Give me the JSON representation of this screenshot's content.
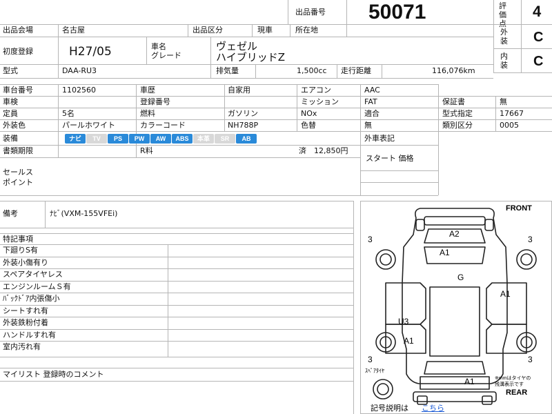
{
  "header": {
    "lot_label": "出品番号",
    "lot_number": "50071",
    "venue_label": "出品会場",
    "venue_value": "名古屋",
    "category_label": "出品区分",
    "category_value": "現車",
    "location_label": "所在地",
    "location_value": ""
  },
  "scores": {
    "eval_label": "評価点",
    "eval_value": "4",
    "exterior_label": "外装",
    "exterior_value": "C",
    "interior_label": "内装",
    "interior_value": "C"
  },
  "vehicle": {
    "first_reg_label": "初度登録",
    "first_reg_value": "H27/05",
    "name_label": "車名",
    "grade_label": "グレード",
    "name_value": "ヴェゼル",
    "grade_value": "ハイブリッドZ",
    "model_label": "型式",
    "model_value": "DAA-RU3",
    "displacement_label": "排気量",
    "displacement_value": "1,500cc",
    "mileage_label": "走行距離",
    "mileage_value": "116,076km"
  },
  "details": {
    "chassis_label": "車台番号",
    "chassis_value": "1102560",
    "history_label": "車歴",
    "history_value": "自家用",
    "ac_label": "エアコン",
    "ac_value": "AAC",
    "inspection_label": "車検",
    "regno_label": "登録番号",
    "mission_label": "ミッション",
    "mission_value": "FAT",
    "warranty_label": "保証書",
    "warranty_value": "無",
    "capacity_label": "定員",
    "capacity_value": "5名",
    "fuel_label": "燃料",
    "fuel_value": "ガソリン",
    "nox_label": "NOx",
    "nox_value": "適合",
    "typecert_label": "型式指定",
    "typecert_value": "17667",
    "color_label": "外装色",
    "color_value": "パールホワイト",
    "colorcode_label": "カラーコード",
    "colorcode_value": "NH788P",
    "repaint_label": "色替",
    "repaint_value": "無",
    "class_label": "類別区分",
    "class_value": "0005",
    "equip_label": "装備",
    "equipment": [
      {
        "label": "ナビ",
        "on": true
      },
      {
        "label": "TV",
        "on": false
      },
      {
        "label": "PS",
        "on": true
      },
      {
        "label": "PW",
        "on": true
      },
      {
        "label": "AW",
        "on": true
      },
      {
        "label": "ABS",
        "on": true
      },
      {
        "label": "本革",
        "on": false
      },
      {
        "label": "SR",
        "on": false
      },
      {
        "label": "AB",
        "on": true
      }
    ],
    "docs_label": "書類期限",
    "r_label": "R料",
    "r_value": "済　12,850円",
    "foreign_label": "外車表記",
    "start_price_label": "スタート 価格",
    "sales_label": "セールス\nポイント"
  },
  "remarks": {
    "label": "備考",
    "value": "ﾅﾋﾞ(VXM-155VFEi)"
  },
  "notes": {
    "title": "特記事項",
    "items": [
      "下廻りS有",
      "外装小傷有り",
      "スペアタイヤレス",
      "エンジンルームＳ有",
      "ﾊﾞｯｸﾄﾞｱ内張傷小",
      "シートすれ有",
      "外装鉄粉付着",
      "ハンドルすれ有",
      "室内汚れ有"
    ]
  },
  "mylist": {
    "label": "マイリスト 登録時のコメント"
  },
  "diagram": {
    "front_label": "FRONT",
    "rear_label": "REAR",
    "spare_label": "ｽﾍﾟｱﾀｲﾔ",
    "note": "※mmはタイヤの\n残溝表示です",
    "marks": [
      "A2",
      "A1",
      "G",
      "A1",
      "U3",
      "A1",
      "A1"
    ],
    "tire_marks": [
      "3",
      "3",
      "3",
      "3"
    ],
    "legend_text": "記号説明は",
    "legend_link": "こちら"
  }
}
